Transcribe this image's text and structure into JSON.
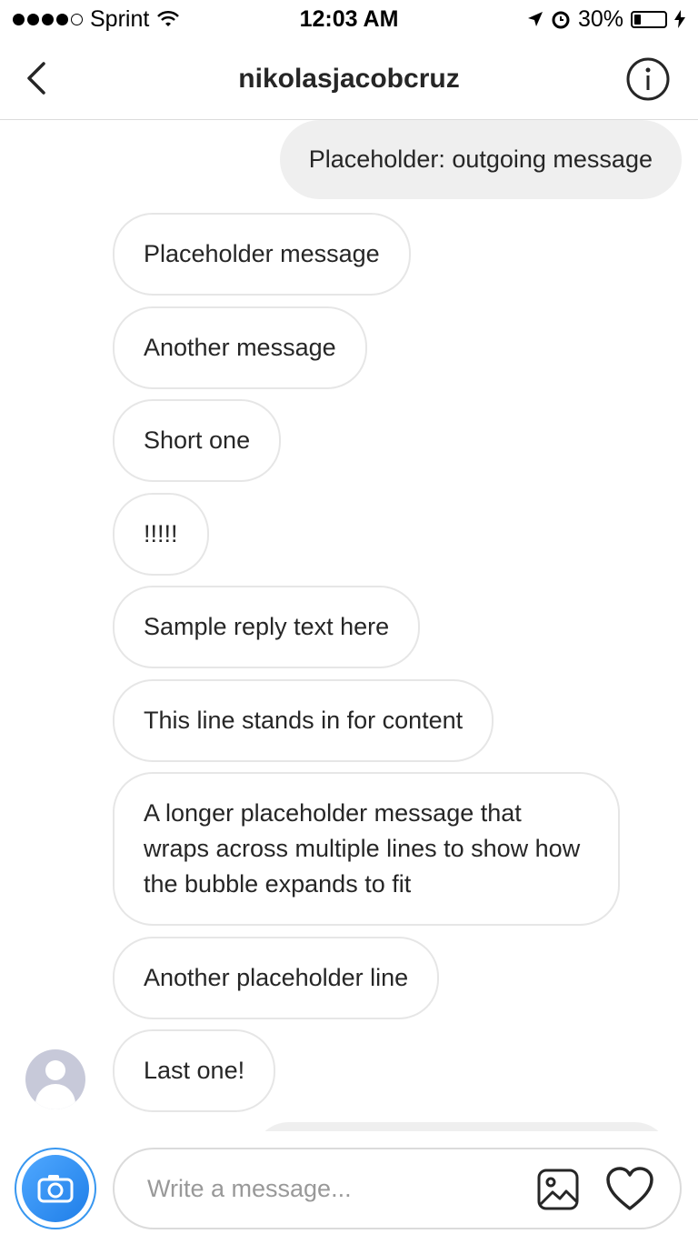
{
  "status_bar": {
    "carrier": "Sprint",
    "time": "12:03 AM",
    "battery_text": "30%",
    "battery_level": 0.3,
    "signal_bars_filled": 4,
    "signal_bars_total": 5
  },
  "header": {
    "title": "nikolasjacobcruz",
    "back_icon": "chevron-left-icon",
    "info_icon": "info-circle-icon"
  },
  "thread": {
    "outgoing": [
      {
        "text": "Placeholder: outgoing message"
      }
    ],
    "incoming": [
      {
        "text": "Placeholder message"
      },
      {
        "text": "Another message"
      },
      {
        "text": "Short one"
      },
      {
        "text": "!!!!!"
      },
      {
        "text": "Sample reply text here"
      },
      {
        "text": "This line stands in for content"
      },
      {
        "text": "A longer placeholder message that wraps across multiple lines to show how the bubble expands to fit"
      },
      {
        "text": "Another placeholder line"
      },
      {
        "text": "Last one!"
      }
    ]
  },
  "composer": {
    "placeholder": "Write a message...",
    "camera_icon": "camera-icon",
    "gallery_icon": "image-icon",
    "like_icon": "heart-icon"
  },
  "colors": {
    "accent": "#3897f0",
    "outgoing_bubble": "#efefef",
    "incoming_border": "#e6e6e6",
    "text": "#262626"
  }
}
